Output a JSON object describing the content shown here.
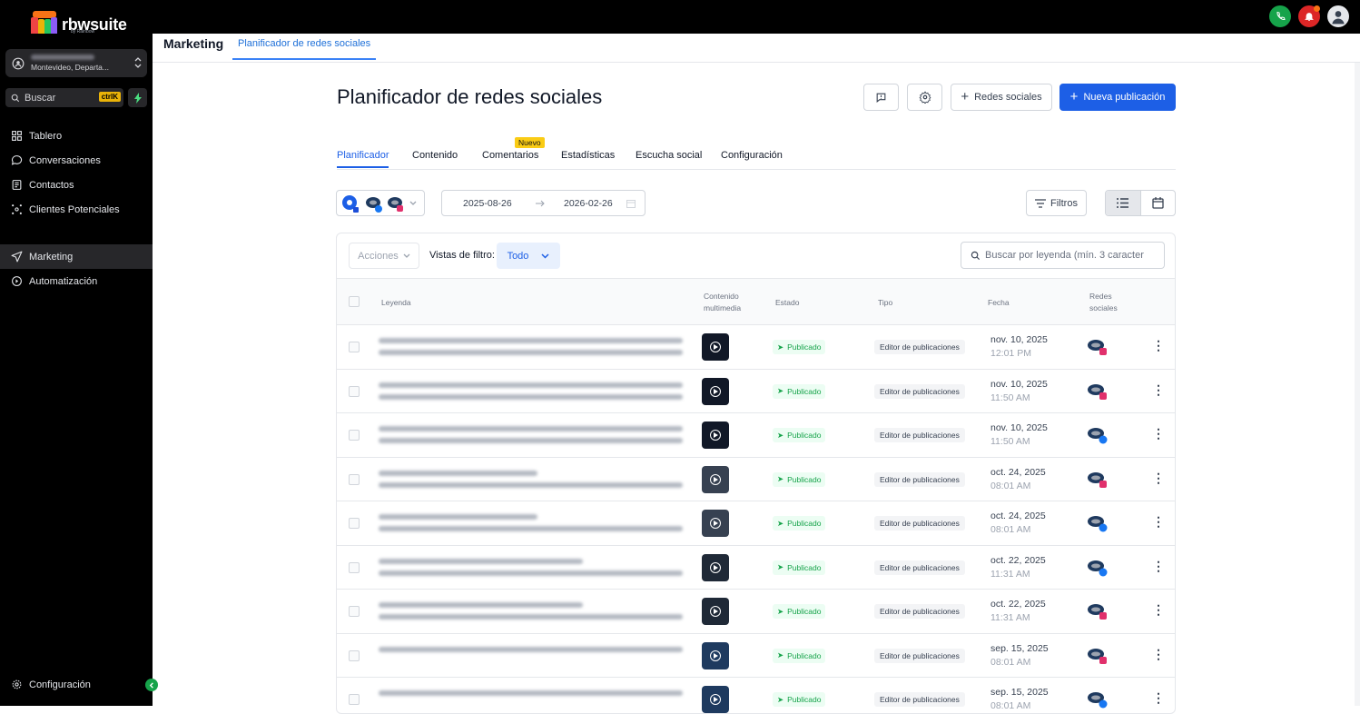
{
  "app": {
    "brand": "rbwsuite",
    "brand_sub": "by Rainbow"
  },
  "topbar": {
    "icons": [
      "phone-icon",
      "bell-icon",
      "user-avatar"
    ]
  },
  "sidebar": {
    "account": {
      "location": "Montevideo, Departa..."
    },
    "search": {
      "placeholder": "Buscar",
      "shortcut": "ctrlK"
    },
    "items": [
      {
        "label": "Tablero",
        "icon": "dashboard-icon"
      },
      {
        "label": "Conversaciones",
        "icon": "chat-icon"
      },
      {
        "label": "Contactos",
        "icon": "contacts-icon"
      },
      {
        "label": "Clientes Potenciales",
        "icon": "leads-icon"
      },
      {
        "label": "Marketing",
        "icon": "send-icon",
        "active": true
      },
      {
        "label": "Automatización",
        "icon": "automation-icon"
      }
    ],
    "settings": "Configuración"
  },
  "header": {
    "section": "Marketing",
    "tab": "Planificador de redes sociales"
  },
  "page": {
    "title": "Planificador de redes sociales",
    "buttons": {
      "social": "Redes sociales",
      "new_post": "Nueva publicación"
    },
    "tabs": [
      "Planificador",
      "Contenido",
      "Comentarios",
      "Estadísticas",
      "Escucha social",
      "Configuración"
    ],
    "new_badge": "Nuevo"
  },
  "filters": {
    "date_from": "2025-08-26",
    "date_to": "2026-02-26",
    "filters_label": "Filtros"
  },
  "table": {
    "actions_label": "Acciones",
    "views_label": "Vistas de filtro:",
    "view_value": "Todo",
    "search_placeholder": "Buscar por leyenda (mín. 3 caracter",
    "columns": {
      "caption": "Leyenda",
      "media_1": "Contenido",
      "media_2": "multimedia",
      "status": "Estado",
      "type": "Tipo",
      "date": "Fecha",
      "networks_1": "Redes",
      "networks_2": "sociales"
    },
    "rows": [
      {
        "status": "Publicado",
        "type": "Editor de publicaciones",
        "date": "nov. 10, 2025",
        "time": "12:01 PM",
        "network": "instagram"
      },
      {
        "status": "Publicado",
        "type": "Editor de publicaciones",
        "date": "nov. 10, 2025",
        "time": "11:50 AM",
        "network": "instagram"
      },
      {
        "status": "Publicado",
        "type": "Editor de publicaciones",
        "date": "nov. 10, 2025",
        "time": "11:50 AM",
        "network": "facebook"
      },
      {
        "status": "Publicado",
        "type": "Editor de publicaciones",
        "date": "oct. 24, 2025",
        "time": "08:01 AM",
        "network": "instagram"
      },
      {
        "status": "Publicado",
        "type": "Editor de publicaciones",
        "date": "oct. 24, 2025",
        "time": "08:01 AM",
        "network": "facebook"
      },
      {
        "status": "Publicado",
        "type": "Editor de publicaciones",
        "date": "oct. 22, 2025",
        "time": "11:31 AM",
        "network": "facebook"
      },
      {
        "status": "Publicado",
        "type": "Editor de publicaciones",
        "date": "oct. 22, 2025",
        "time": "11:31 AM",
        "network": "instagram"
      },
      {
        "status": "Publicado",
        "type": "Editor de publicaciones",
        "date": "sep. 15, 2025",
        "time": "08:01 AM",
        "network": "instagram"
      },
      {
        "status": "Publicado",
        "type": "Editor de publicaciones",
        "date": "sep. 15, 2025",
        "time": "08:01 AM",
        "network": "facebook"
      }
    ]
  },
  "colors": {
    "primary": "#1d5fe6",
    "success": "#16a34a",
    "sidebar": "#000000"
  }
}
